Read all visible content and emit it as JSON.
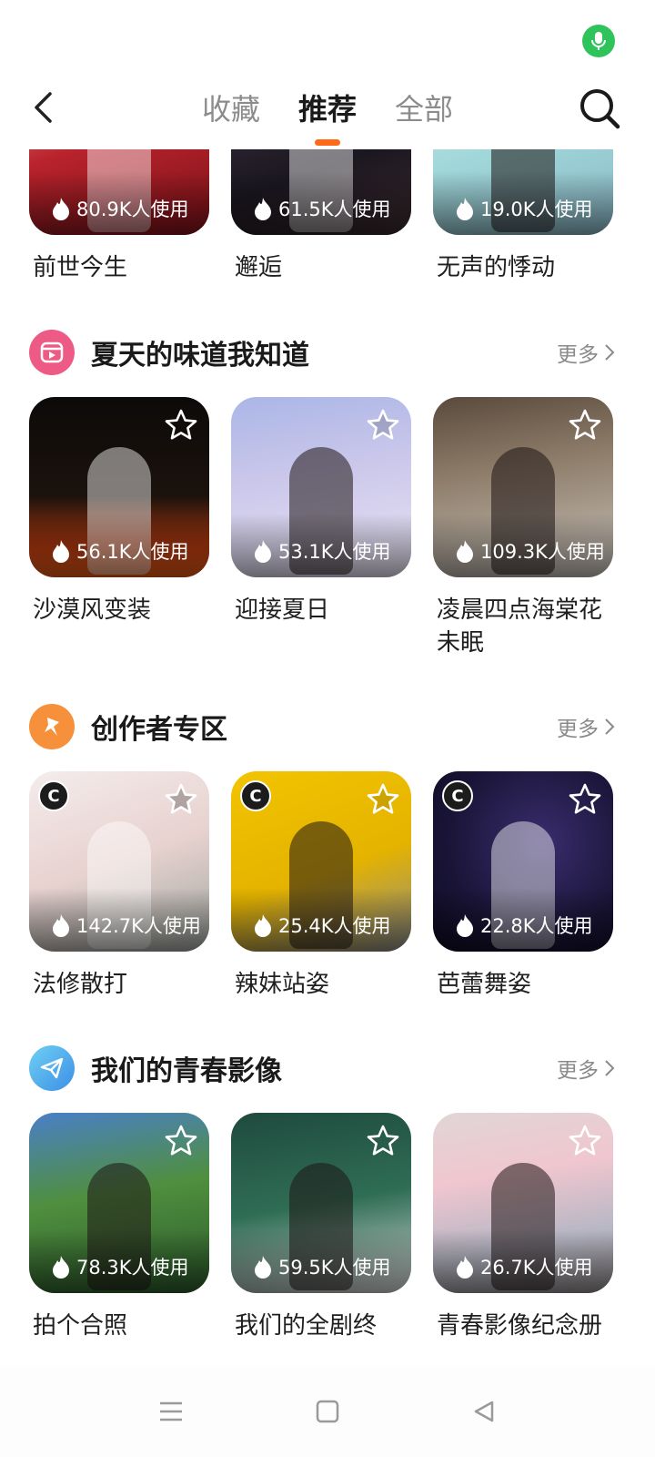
{
  "header": {
    "tabs": [
      {
        "label": "收藏",
        "active": false
      },
      {
        "label": "推荐",
        "active": true
      },
      {
        "label": "全部",
        "active": false
      }
    ],
    "accent_color": "#ff6a1a"
  },
  "top_row": [
    {
      "title": "前世今生",
      "usage": "80.9K人使用"
    },
    {
      "title": "邂逅",
      "usage": "61.5K人使用"
    },
    {
      "title": "无声的悸动",
      "usage": "19.0K人使用"
    }
  ],
  "sections": [
    {
      "title": "夏天的味道我知道",
      "more": "更多",
      "icon": "video-reel-icon",
      "items": [
        {
          "title": "沙漠风变装",
          "usage": "56.1K人使用"
        },
        {
          "title": "迎接夏日",
          "usage": "53.1K人使用"
        },
        {
          "title": "凌晨四点海棠花未眠",
          "usage": "109.3K人使用"
        }
      ]
    },
    {
      "title": "创作者专区",
      "more": "更多",
      "icon": "sparkle-pin-icon",
      "items": [
        {
          "title": "法修散打",
          "usage": "142.7K人使用",
          "badge": "C"
        },
        {
          "title": "辣妹站姿",
          "usage": "25.4K人使用",
          "badge": "C"
        },
        {
          "title": "芭蕾舞姿",
          "usage": "22.8K人使用",
          "badge": "C"
        }
      ]
    },
    {
      "title": "我们的青春影像",
      "more": "更多",
      "icon": "paper-plane-icon",
      "items": [
        {
          "title": "拍个合照",
          "usage": "78.3K人使用"
        },
        {
          "title": "我们的全剧终",
          "usage": "59.5K人使用"
        },
        {
          "title": "青春影像纪念册",
          "usage": "26.7K人使用"
        }
      ]
    }
  ]
}
